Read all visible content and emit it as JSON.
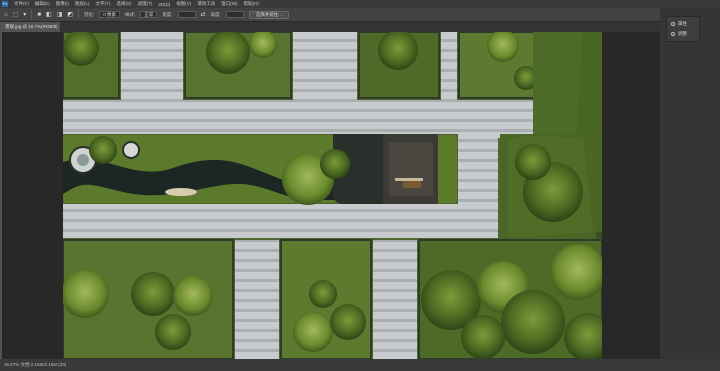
{
  "app": {
    "logo": "Ps"
  },
  "menu": [
    "文件(F)",
    "编辑(E)",
    "图像(I)",
    "图层(L)",
    "文字(Y)",
    "选择(S)",
    "滤镜(T)",
    "3D(D)",
    "视图(V)",
    "增效工具",
    "窗口(W)",
    "帮助(H)"
  ],
  "options": {
    "tool_icon": "marquee-icon",
    "feather_label": "羽化:",
    "feather_value": "0 像素",
    "style_label": "样式:",
    "style_value": "正常",
    "width_label": "宽度:",
    "height_label": "高度:",
    "select_mask_button": "选择并遮住..."
  },
  "document": {
    "tab_title": "景观.jpg @ 16.7%(RGB/8)"
  },
  "panels": {
    "items": [
      {
        "label": "属性",
        "icon": "properties-icon"
      },
      {
        "label": "调整",
        "icon": "adjustments-icon"
      }
    ]
  },
  "status": {
    "text": "16.67%    文档:2.16M/2.16M    (20)"
  },
  "colors": {
    "ui_dark": "#282828",
    "ui_panel": "#3a3a3a",
    "lawn": "#4f6a2c",
    "paving": "#c9cdd0"
  }
}
